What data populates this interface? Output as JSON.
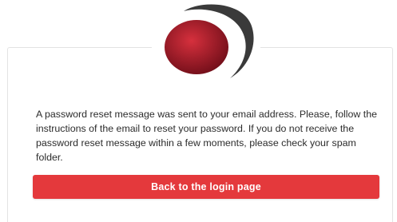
{
  "logo": {
    "icon": "brand-logo-icon",
    "colors": {
      "disc_light": "#d6303d",
      "disc_dark": "#6e0d18",
      "swoosh": "#3a3a3a"
    }
  },
  "reset_notice": {
    "message": "A password reset message was sent to your email address. Please, follow the instructions of the email to reset your password. If you do not receive the password reset message within a few moments, please check your spam folder."
  },
  "actions": {
    "back_label": "Back to the login page",
    "accent_color": "#e4393c"
  }
}
